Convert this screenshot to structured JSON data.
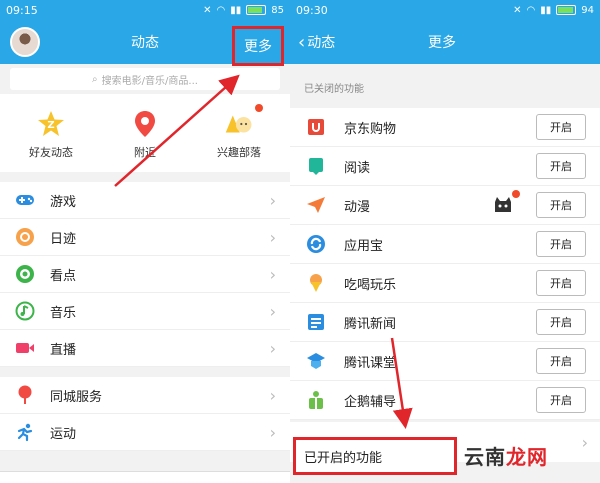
{
  "left": {
    "status": {
      "time": "09:15",
      "battery": "85",
      "battery_level": 0.85
    },
    "header": {
      "title": "动态",
      "more": "更多"
    },
    "search": {
      "placeholder": "搜索电影/音乐/商品..."
    },
    "quick": [
      {
        "label": "好友动态",
        "icon": "star-badge-icon"
      },
      {
        "label": "附近",
        "icon": "location-pin-icon"
      },
      {
        "label": "兴趣部落",
        "icon": "tribe-icon"
      }
    ],
    "menu1": [
      {
        "label": "游戏",
        "icon": "gamepad-icon"
      },
      {
        "label": "日迹",
        "icon": "camera-ring-icon"
      },
      {
        "label": "看点",
        "icon": "eye-icon"
      },
      {
        "label": "音乐",
        "icon": "music-icon"
      },
      {
        "label": "直播",
        "icon": "video-icon"
      }
    ],
    "menu2": [
      {
        "label": "同城服务",
        "icon": "pin-icon"
      },
      {
        "label": "运动",
        "icon": "runner-icon"
      }
    ]
  },
  "right": {
    "status": {
      "time": "09:30",
      "battery": "94",
      "battery_level": 0.94
    },
    "header": {
      "back": "动态",
      "title": "更多"
    },
    "section_closed": "已关闭的功能",
    "features": [
      {
        "label": "京东购物",
        "icon": "jd-icon",
        "button": "开启"
      },
      {
        "label": "阅读",
        "icon": "book-icon",
        "button": "开启"
      },
      {
        "label": "动漫",
        "icon": "paper-plane-icon",
        "button": "开启"
      },
      {
        "label": "应用宝",
        "icon": "app-store-icon",
        "button": "开启"
      },
      {
        "label": "吃喝玩乐",
        "icon": "ice-cream-icon",
        "button": "开启"
      },
      {
        "label": "腾讯新闻",
        "icon": "news-icon",
        "button": "开启"
      },
      {
        "label": "腾讯课堂",
        "icon": "classroom-icon",
        "button": "开启"
      },
      {
        "label": "企鹅辅导",
        "icon": "tutor-icon",
        "button": "开启"
      }
    ],
    "section_enabled": "已开启的功能",
    "watermark": {
      "part1": "云南",
      "part2": "龙网"
    }
  },
  "colors": {
    "header": "#29a7e6",
    "highlight": "#e0252b"
  }
}
